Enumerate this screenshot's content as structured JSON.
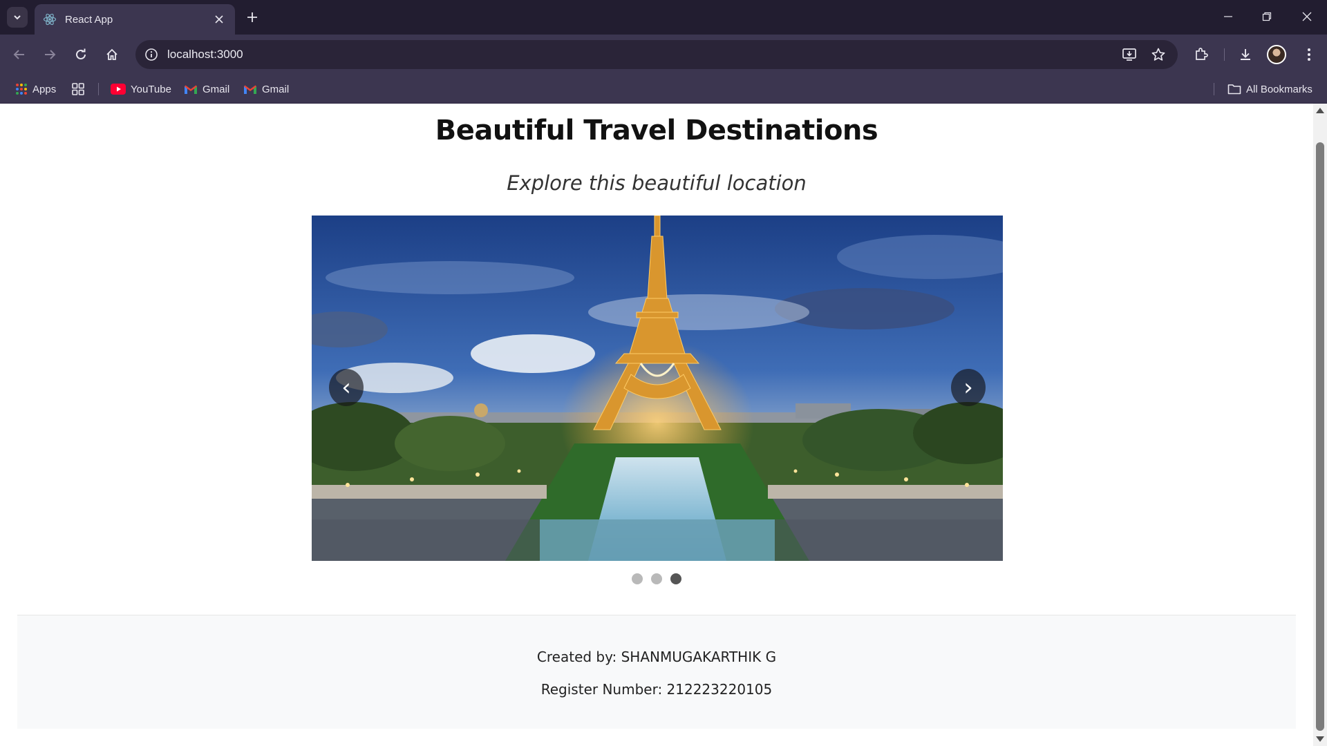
{
  "browser": {
    "tab_title": "React App",
    "url": "localhost:3000",
    "bookmarks": [
      {
        "label": "Apps",
        "icon": "apps-grid-icon"
      },
      {
        "label": "",
        "icon": "tab-groups-icon"
      },
      {
        "label": "YouTube",
        "icon": "youtube-icon"
      },
      {
        "label": "Gmail",
        "icon": "gmail-icon"
      },
      {
        "label": "Gmail",
        "icon": "gmail-icon"
      }
    ],
    "all_bookmarks": "All Bookmarks",
    "colors": {
      "frame": "#221d30",
      "toolbar": "#3c3650",
      "omnibox": "#2a2438"
    }
  },
  "page": {
    "title": "Beautiful Travel Destinations",
    "subtitle": "Explore this beautiful location",
    "carousel": {
      "image": "eiffel-tower-paris-night",
      "prev_symbol": "‹",
      "next_symbol": "›",
      "slide_count": 3,
      "active_slide": 3
    },
    "footer": {
      "created_by": "Created by: SHANMUGAKARTHIK G",
      "register_number": "Register Number: 212223220105"
    }
  }
}
